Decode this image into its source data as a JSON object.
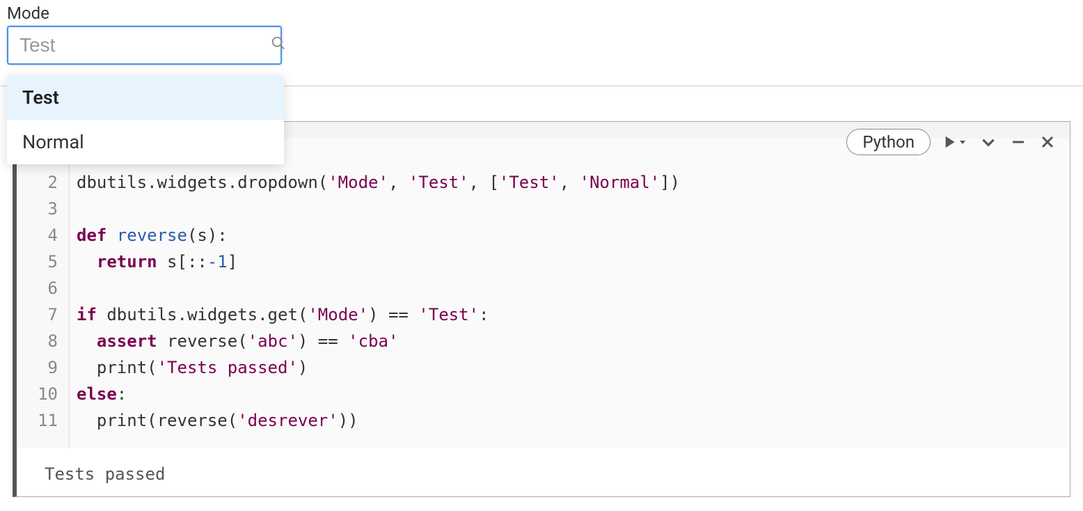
{
  "widget": {
    "label": "Mode",
    "placeholder": "Test",
    "options": [
      "Test",
      "Normal"
    ],
    "selected": "Test"
  },
  "cell": {
    "language": "Python",
    "icons": {
      "run": "play-icon",
      "expand": "chevron-down-icon",
      "minimize": "minus-icon",
      "close": "close-icon"
    },
    "gutter": [
      "2",
      "3",
      "4",
      "5",
      "6",
      "7",
      "8",
      "9",
      "10",
      "11"
    ],
    "code": {
      "l2_a": "dbutils.widgets.dropdown(",
      "l2_s1": "'Mode'",
      "l2_b": ", ",
      "l2_s2": "'Test'",
      "l2_c": ", [",
      "l2_s3": "'Test'",
      "l2_d": ", ",
      "l2_s4": "'Normal'",
      "l2_e": "])",
      "l3": "",
      "l4_kw": "def",
      "l4_fn": " reverse",
      "l4_rest": "(s):",
      "l5_indent": "  ",
      "l5_kw": "return",
      "l5_a": " s[::",
      "l5_num": "-1",
      "l5_b": "]",
      "l6": "",
      "l7_kw": "if",
      "l7_a": " dbutils.widgets.get(",
      "l7_s1": "'Mode'",
      "l7_b": ") == ",
      "l7_s2": "'Test'",
      "l7_c": ":",
      "l8_indent": "  ",
      "l8_kw": "assert",
      "l8_a": " reverse(",
      "l8_s1": "'abc'",
      "l8_b": ") == ",
      "l8_s2": "'cba'",
      "l9_indent": "  ",
      "l9_a": "print(",
      "l9_s1": "'Tests passed'",
      "l9_b": ")",
      "l10_kw": "else",
      "l10_a": ":",
      "l11_indent": "  ",
      "l11_a": "print(reverse(",
      "l11_s1": "'desrever'",
      "l11_b": "))"
    },
    "output": "Tests passed"
  }
}
